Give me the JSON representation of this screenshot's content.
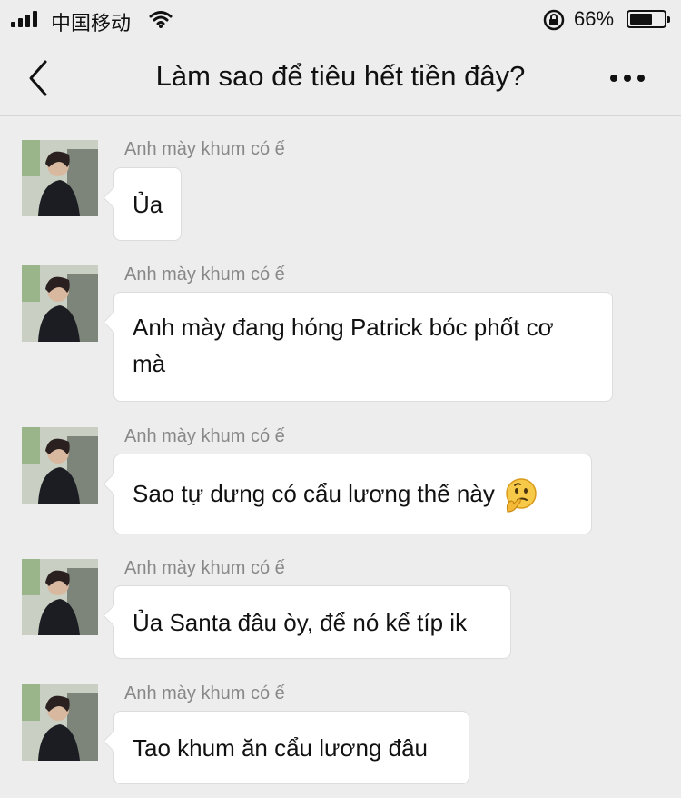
{
  "status_bar": {
    "carrier": "中国移动",
    "battery_percent": "66%",
    "battery_level": 0.66
  },
  "nav": {
    "title": "Làm sao để tiêu hết tiền đây?"
  },
  "messages": [
    {
      "sender": "Anh mày khum có ế",
      "lines": [
        "Ủa"
      ]
    },
    {
      "sender": "Anh mày khum có ế",
      "lines": [
        "Anh mày đang hóng Patrick bóc phốt cơ",
        "mà"
      ]
    },
    {
      "sender": "Anh mày khum có ế",
      "lines": [
        "Sao tự dưng có cẩu lương thế này"
      ],
      "emoji": "thinking-face-emoji"
    },
    {
      "sender": "Anh mày khum có ế",
      "lines": [
        "Ủa Santa đâu òy, để nó kể típ ik"
      ]
    },
    {
      "sender": "Anh mày khum có ế",
      "lines": [
        "Tao khum ăn cẩu lương đâu"
      ]
    }
  ]
}
